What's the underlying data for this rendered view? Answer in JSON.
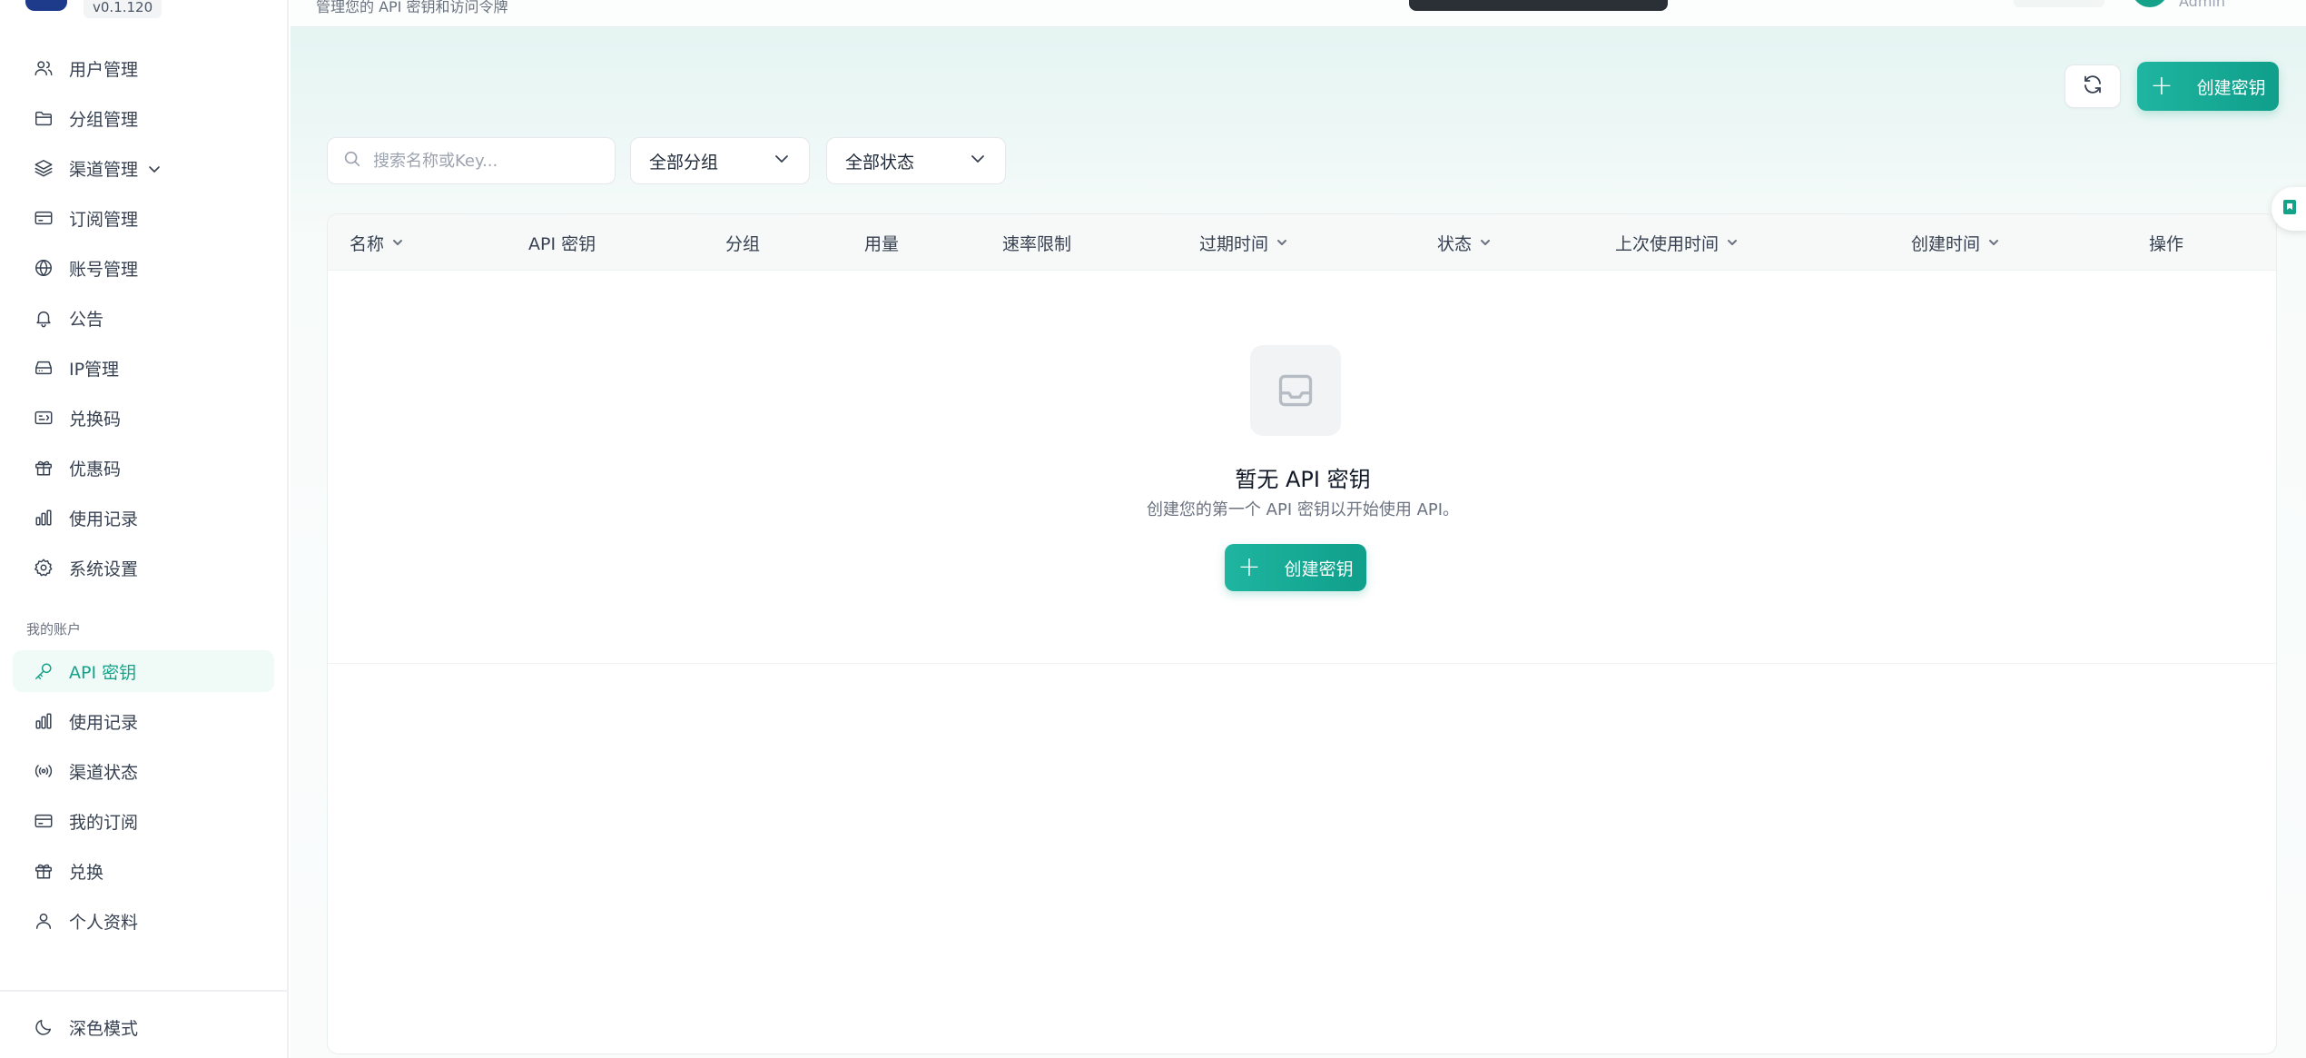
{
  "brand": {
    "version": "v0.1.120"
  },
  "sidebar": {
    "admin_items": [
      {
        "label": "用户管理",
        "icon": "users-icon"
      },
      {
        "label": "分组管理",
        "icon": "folder-icon"
      },
      {
        "label": "渠道管理",
        "icon": "layers-icon",
        "expandable": true
      },
      {
        "label": "订阅管理",
        "icon": "card-icon"
      },
      {
        "label": "账号管理",
        "icon": "globe-icon"
      },
      {
        "label": "公告",
        "icon": "bell-icon"
      },
      {
        "label": "IP管理",
        "icon": "server-icon"
      },
      {
        "label": "兑换码",
        "icon": "ticket-icon"
      },
      {
        "label": "优惠码",
        "icon": "gift-icon"
      },
      {
        "label": "使用记录",
        "icon": "bar-chart-icon"
      },
      {
        "label": "系统设置",
        "icon": "gear-icon"
      }
    ],
    "section_label": "我的账户",
    "account_items": [
      {
        "label": "API 密钥",
        "icon": "key-icon",
        "active": true
      },
      {
        "label": "使用记录",
        "icon": "bar-chart-icon"
      },
      {
        "label": "渠道状态",
        "icon": "broadcast-icon"
      },
      {
        "label": "我的订阅",
        "icon": "card-icon"
      },
      {
        "label": "兑换",
        "icon": "gift-icon"
      },
      {
        "label": "个人资料",
        "icon": "user-icon"
      }
    ],
    "dark_mode_label": "深色模式"
  },
  "topbar": {
    "subtitle": "管理您的 API 密钥和访问令牌",
    "user": "Admin"
  },
  "toolbar": {
    "create_label": "创建密钥",
    "search_placeholder": "搜索名称或Key...",
    "group_filter": "全部分组",
    "status_filter": "全部状态"
  },
  "table": {
    "columns": [
      {
        "label": "名称",
        "sortable": true
      },
      {
        "label": "API 密钥",
        "sortable": false
      },
      {
        "label": "分组",
        "sortable": false
      },
      {
        "label": "用量",
        "sortable": false
      },
      {
        "label": "速率限制",
        "sortable": false
      },
      {
        "label": "过期时间",
        "sortable": true
      },
      {
        "label": "状态",
        "sortable": true
      },
      {
        "label": "上次使用时间",
        "sortable": true
      },
      {
        "label": "创建时间",
        "sortable": true
      },
      {
        "label": "操作",
        "sortable": false
      }
    ],
    "rows": []
  },
  "empty_state": {
    "title": "暂无 API 密钥",
    "description": "创建您的第一个 API 密钥以开始使用 API。",
    "button_label": "创建密钥"
  },
  "colors": {
    "accent": "#14a389",
    "sidebar_active_bg": "#f0fbf8"
  }
}
